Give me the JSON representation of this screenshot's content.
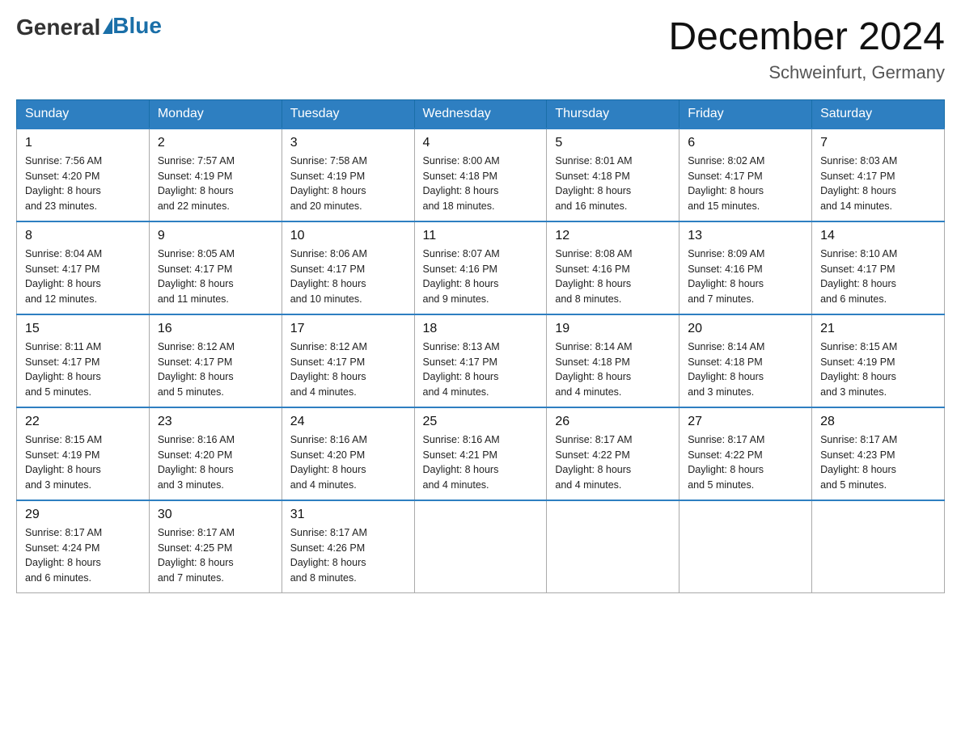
{
  "header": {
    "logo_general": "General",
    "logo_blue": "Blue",
    "month_title": "December 2024",
    "location": "Schweinfurt, Germany"
  },
  "days_of_week": [
    "Sunday",
    "Monday",
    "Tuesday",
    "Wednesday",
    "Thursday",
    "Friday",
    "Saturday"
  ],
  "weeks": [
    [
      {
        "day": "1",
        "sunrise": "7:56 AM",
        "sunset": "4:20 PM",
        "daylight": "8 hours and 23 minutes."
      },
      {
        "day": "2",
        "sunrise": "7:57 AM",
        "sunset": "4:19 PM",
        "daylight": "8 hours and 22 minutes."
      },
      {
        "day": "3",
        "sunrise": "7:58 AM",
        "sunset": "4:19 PM",
        "daylight": "8 hours and 20 minutes."
      },
      {
        "day": "4",
        "sunrise": "8:00 AM",
        "sunset": "4:18 PM",
        "daylight": "8 hours and 18 minutes."
      },
      {
        "day": "5",
        "sunrise": "8:01 AM",
        "sunset": "4:18 PM",
        "daylight": "8 hours and 16 minutes."
      },
      {
        "day": "6",
        "sunrise": "8:02 AM",
        "sunset": "4:17 PM",
        "daylight": "8 hours and 15 minutes."
      },
      {
        "day": "7",
        "sunrise": "8:03 AM",
        "sunset": "4:17 PM",
        "daylight": "8 hours and 14 minutes."
      }
    ],
    [
      {
        "day": "8",
        "sunrise": "8:04 AM",
        "sunset": "4:17 PM",
        "daylight": "8 hours and 12 minutes."
      },
      {
        "day": "9",
        "sunrise": "8:05 AM",
        "sunset": "4:17 PM",
        "daylight": "8 hours and 11 minutes."
      },
      {
        "day": "10",
        "sunrise": "8:06 AM",
        "sunset": "4:17 PM",
        "daylight": "8 hours and 10 minutes."
      },
      {
        "day": "11",
        "sunrise": "8:07 AM",
        "sunset": "4:16 PM",
        "daylight": "8 hours and 9 minutes."
      },
      {
        "day": "12",
        "sunrise": "8:08 AM",
        "sunset": "4:16 PM",
        "daylight": "8 hours and 8 minutes."
      },
      {
        "day": "13",
        "sunrise": "8:09 AM",
        "sunset": "4:16 PM",
        "daylight": "8 hours and 7 minutes."
      },
      {
        "day": "14",
        "sunrise": "8:10 AM",
        "sunset": "4:17 PM",
        "daylight": "8 hours and 6 minutes."
      }
    ],
    [
      {
        "day": "15",
        "sunrise": "8:11 AM",
        "sunset": "4:17 PM",
        "daylight": "8 hours and 5 minutes."
      },
      {
        "day": "16",
        "sunrise": "8:12 AM",
        "sunset": "4:17 PM",
        "daylight": "8 hours and 5 minutes."
      },
      {
        "day": "17",
        "sunrise": "8:12 AM",
        "sunset": "4:17 PM",
        "daylight": "8 hours and 4 minutes."
      },
      {
        "day": "18",
        "sunrise": "8:13 AM",
        "sunset": "4:17 PM",
        "daylight": "8 hours and 4 minutes."
      },
      {
        "day": "19",
        "sunrise": "8:14 AM",
        "sunset": "4:18 PM",
        "daylight": "8 hours and 4 minutes."
      },
      {
        "day": "20",
        "sunrise": "8:14 AM",
        "sunset": "4:18 PM",
        "daylight": "8 hours and 3 minutes."
      },
      {
        "day": "21",
        "sunrise": "8:15 AM",
        "sunset": "4:19 PM",
        "daylight": "8 hours and 3 minutes."
      }
    ],
    [
      {
        "day": "22",
        "sunrise": "8:15 AM",
        "sunset": "4:19 PM",
        "daylight": "8 hours and 3 minutes."
      },
      {
        "day": "23",
        "sunrise": "8:16 AM",
        "sunset": "4:20 PM",
        "daylight": "8 hours and 3 minutes."
      },
      {
        "day": "24",
        "sunrise": "8:16 AM",
        "sunset": "4:20 PM",
        "daylight": "8 hours and 4 minutes."
      },
      {
        "day": "25",
        "sunrise": "8:16 AM",
        "sunset": "4:21 PM",
        "daylight": "8 hours and 4 minutes."
      },
      {
        "day": "26",
        "sunrise": "8:17 AM",
        "sunset": "4:22 PM",
        "daylight": "8 hours and 4 minutes."
      },
      {
        "day": "27",
        "sunrise": "8:17 AM",
        "sunset": "4:22 PM",
        "daylight": "8 hours and 5 minutes."
      },
      {
        "day": "28",
        "sunrise": "8:17 AM",
        "sunset": "4:23 PM",
        "daylight": "8 hours and 5 minutes."
      }
    ],
    [
      {
        "day": "29",
        "sunrise": "8:17 AM",
        "sunset": "4:24 PM",
        "daylight": "8 hours and 6 minutes."
      },
      {
        "day": "30",
        "sunrise": "8:17 AM",
        "sunset": "4:25 PM",
        "daylight": "8 hours and 7 minutes."
      },
      {
        "day": "31",
        "sunrise": "8:17 AM",
        "sunset": "4:26 PM",
        "daylight": "8 hours and 8 minutes."
      },
      null,
      null,
      null,
      null
    ]
  ],
  "labels": {
    "sunrise": "Sunrise:",
    "sunset": "Sunset:",
    "daylight": "Daylight:"
  }
}
